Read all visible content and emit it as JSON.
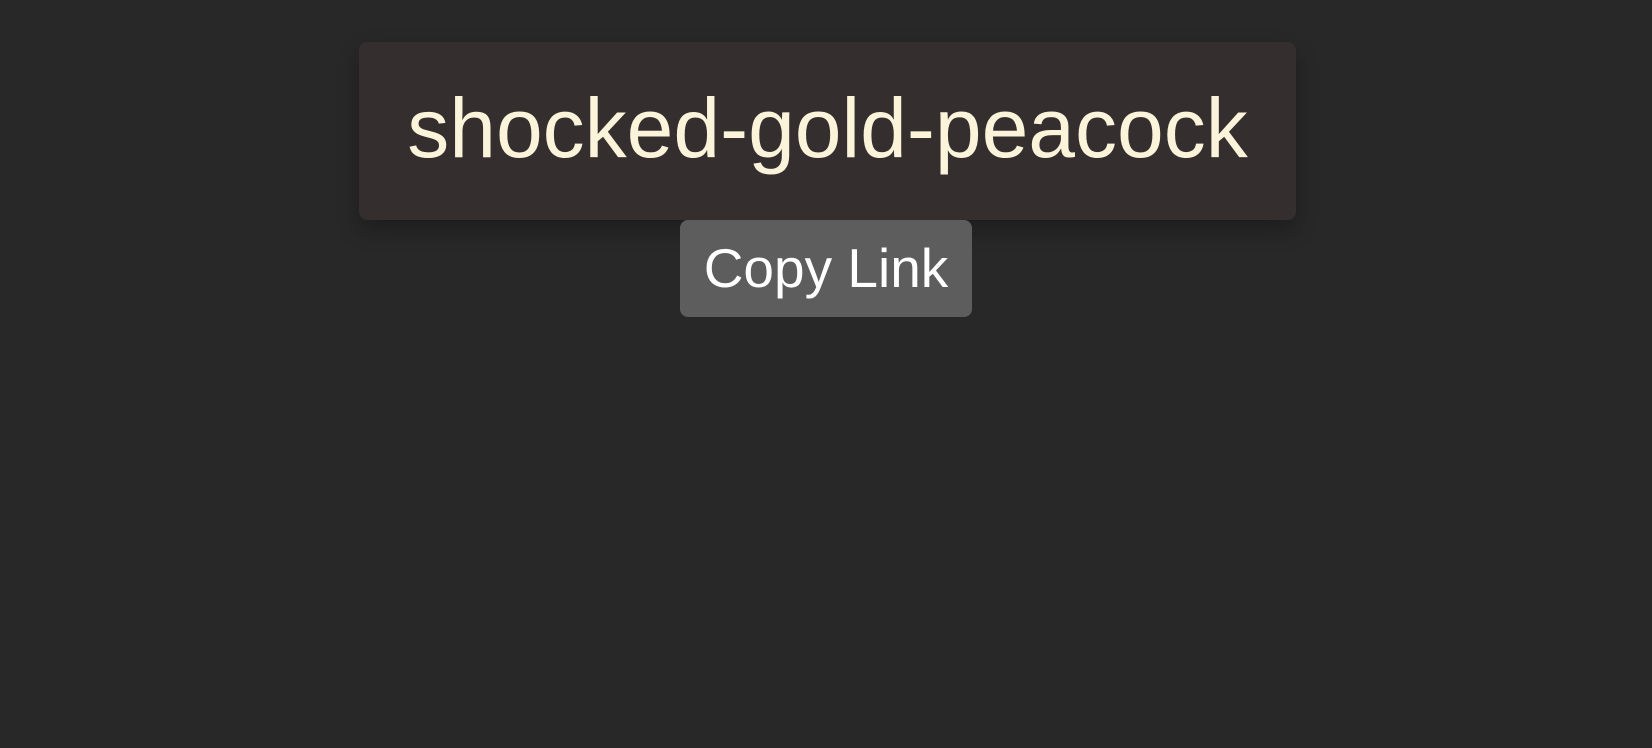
{
  "name_card": {
    "text": "shocked-gold-peacock"
  },
  "actions": {
    "copy_link_label": "Copy Link"
  },
  "colors": {
    "background": "#282828",
    "card_background": "#342f2e",
    "name_text": "#fbf3da",
    "button_background": "#5d5d5d",
    "button_text": "#ffffff"
  }
}
